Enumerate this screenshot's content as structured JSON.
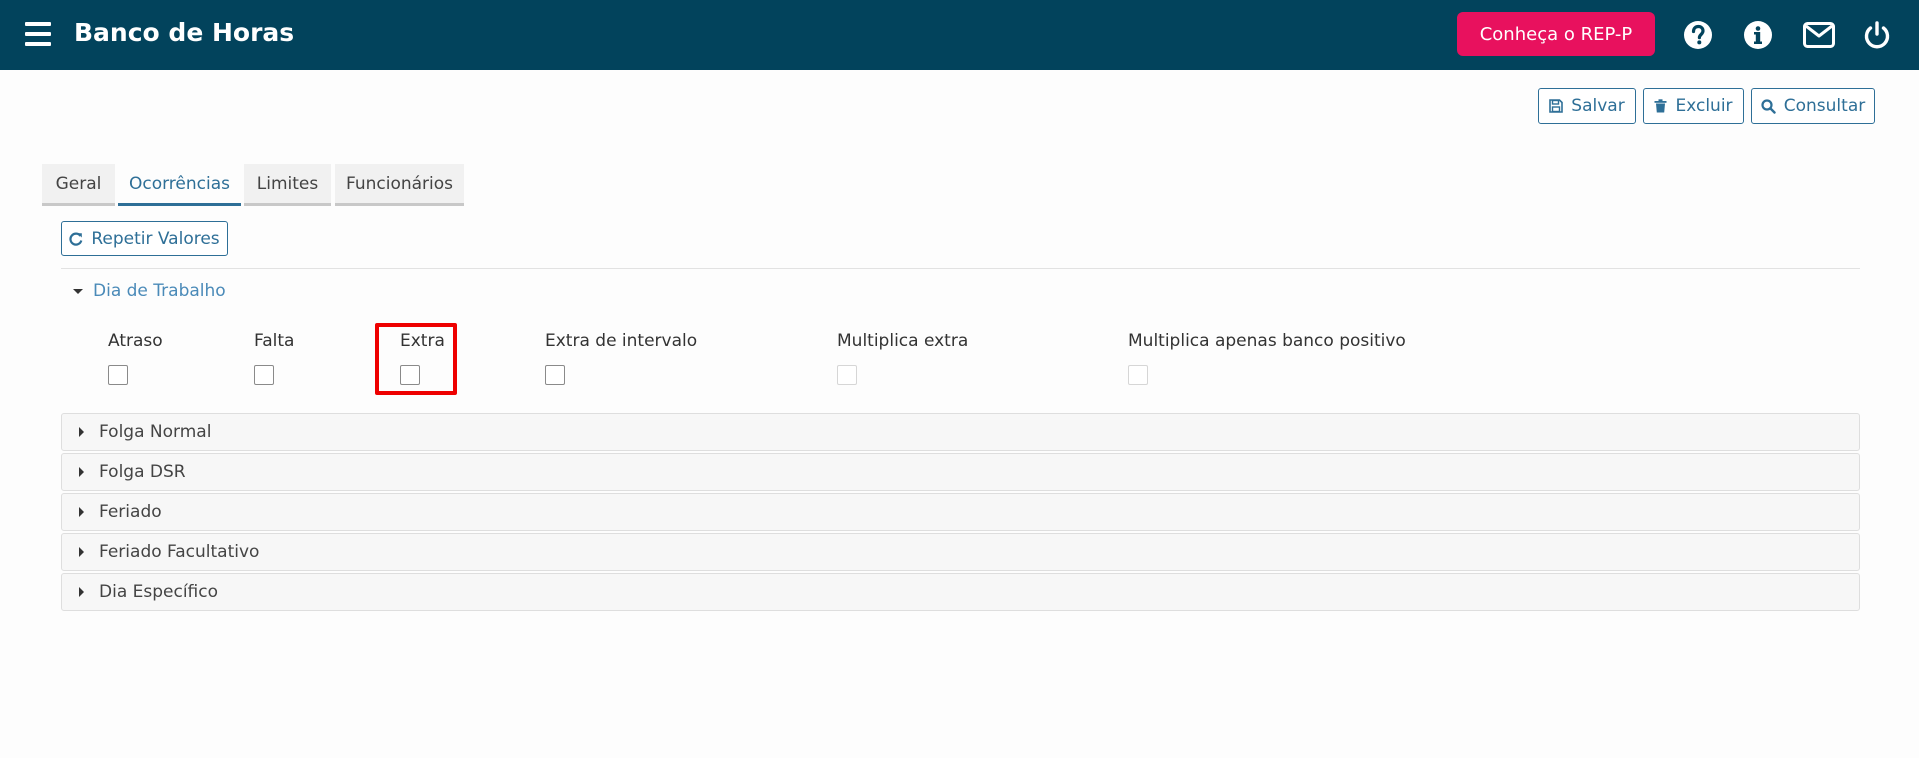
{
  "header": {
    "title": "Banco de Horas",
    "cta_label": "Conheça o REP-P",
    "icons": [
      "menu-icon",
      "help-icon",
      "info-icon",
      "mail-icon",
      "power-icon"
    ],
    "colors": {
      "bar": "#02435c",
      "cta": "#e8115e"
    }
  },
  "actions": {
    "save_label": "Salvar",
    "delete_label": "Excluir",
    "query_label": "Consultar"
  },
  "tabs": [
    {
      "label": "Geral",
      "active": false
    },
    {
      "label": "Ocorrências",
      "active": true
    },
    {
      "label": "Limites",
      "active": false
    },
    {
      "label": "Funcionários",
      "active": false
    }
  ],
  "repeat_label": "Repetir Valores",
  "dia_trabalho": {
    "title": "Dia de Trabalho",
    "fields": [
      {
        "label": "Atraso",
        "checked": false,
        "enabled": true
      },
      {
        "label": "Falta",
        "checked": false,
        "enabled": true
      },
      {
        "label": "Extra",
        "checked": false,
        "enabled": true
      },
      {
        "label": "Extra de intervalo",
        "checked": false,
        "enabled": true
      },
      {
        "label": "Multiplica extra",
        "checked": false,
        "enabled": false
      },
      {
        "label": "Multiplica apenas banco positivo",
        "checked": false,
        "enabled": false
      }
    ]
  },
  "sections": [
    {
      "label": "Folga Normal"
    },
    {
      "label": "Folga DSR"
    },
    {
      "label": "Feriado"
    },
    {
      "label": "Feriado Facultativo"
    },
    {
      "label": "Dia Específico"
    }
  ]
}
